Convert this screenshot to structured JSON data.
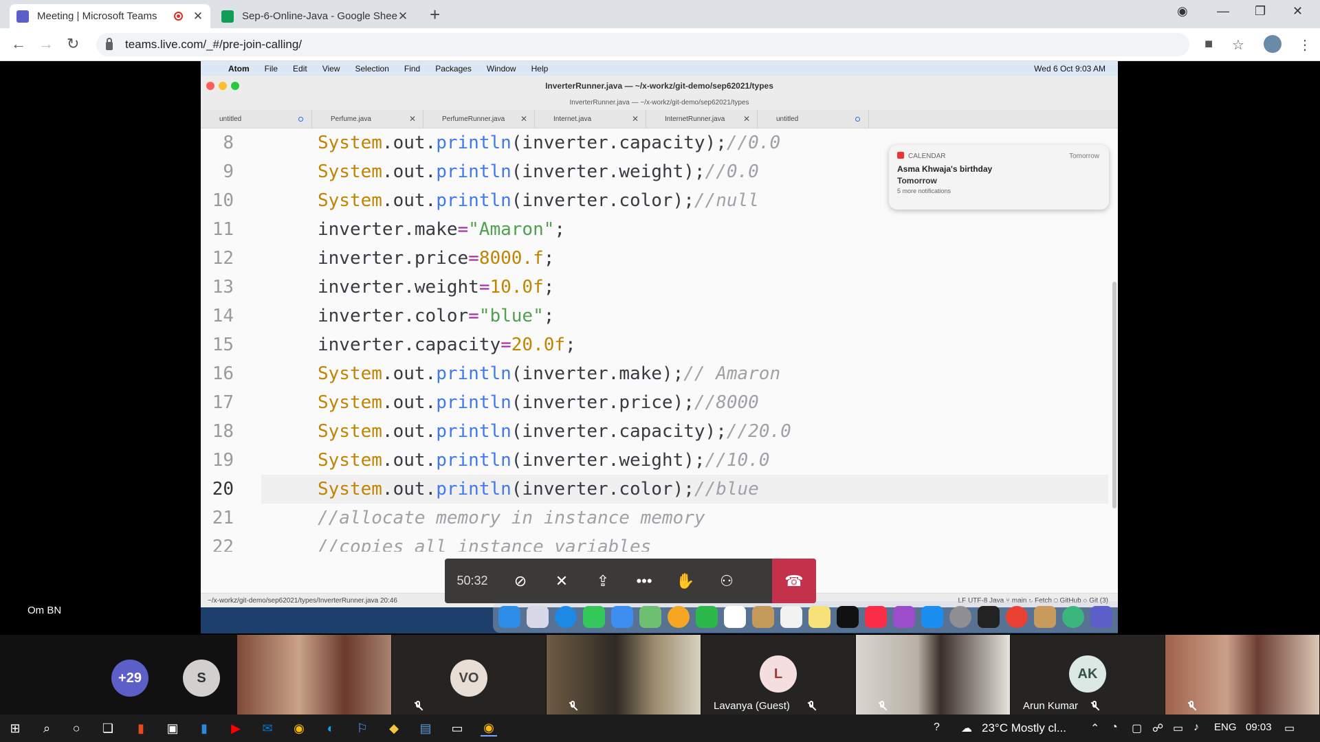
{
  "browser": {
    "tabs": [
      {
        "title": "Meeting | Microsoft Teams",
        "active": true
      },
      {
        "title": "Sep-6-Online-Java - Google Shee",
        "active": false
      }
    ],
    "url": "teams.live.com/_#/pre-join-calling/"
  },
  "mac": {
    "menu": [
      "Atom",
      "File",
      "Edit",
      "View",
      "Selection",
      "Find",
      "Packages",
      "Window",
      "Help"
    ],
    "clock": "Wed 6 Oct  9:03 AM",
    "window_title": "InverterRunner.java — ~/x-workz/git-demo/sep62021/types",
    "window_subtitle": "InverterRunner.java — ~/x-workz/git-demo/sep62021/types",
    "tabs": [
      "untitled",
      "Perfume.java",
      "PerfumeRunner.java",
      "Internet.java",
      "InternetRunner.java",
      "untitled"
    ],
    "notification": {
      "app": "CALENDAR",
      "when": "Tomorrow",
      "headline": "Asma Khwaja's birthday",
      "sub": "Tomorrow",
      "more": "5 more notifications"
    },
    "status_left": "~/x-workz/git-demo/sep62021/types/InverterRunner.java   20:46",
    "status_right": "LF    UTF-8    Java    ⑂ main    ↻ Fetch    ◯ GitHub    ◇ Git (3)"
  },
  "code_lines": [
    {
      "n": "8"
    },
    {
      "n": "9"
    },
    {
      "n": "10"
    },
    {
      "n": "11"
    },
    {
      "n": "12"
    },
    {
      "n": "13"
    },
    {
      "n": "14"
    },
    {
      "n": "15"
    },
    {
      "n": "16"
    },
    {
      "n": "17"
    },
    {
      "n": "18"
    },
    {
      "n": "19"
    },
    {
      "n": "20"
    },
    {
      "n": "21"
    },
    {
      "n": "22"
    }
  ],
  "call": {
    "timer": "50:32",
    "presenter": "Om BN"
  },
  "participants": {
    "overflow": "+29",
    "s": "S",
    "vo": "VO",
    "l": "L",
    "lavanya": "Lavanya (Guest)",
    "ak": "AK",
    "arun": "Arun Kumar"
  },
  "taskbar": {
    "weather": "23°C  Mostly cl...",
    "lang": "ENG",
    "time": "09:03"
  }
}
